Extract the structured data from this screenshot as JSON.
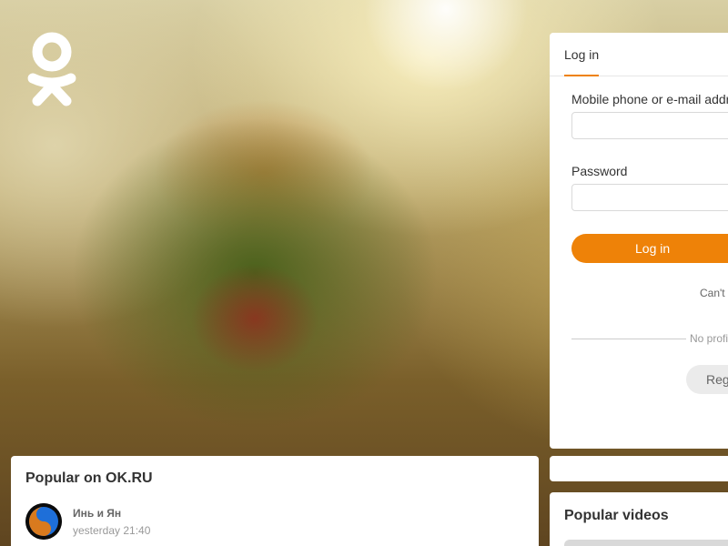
{
  "brand": {
    "logo_icon": "ok-logo-icon",
    "accent_color": "#ee8208"
  },
  "login": {
    "tab_label": "Log in",
    "phone_label": "Mobile phone or e-mail addr",
    "phone_value": "",
    "password_label": "Password",
    "password_value": "",
    "submit_label": "Log in",
    "cant_login_text": "Can't",
    "no_profile_text": "No profi",
    "register_label": "Reg"
  },
  "popular": {
    "title": "Popular on OK.RU",
    "posts": [
      {
        "author": "Инь и Ян",
        "time": "yesterday 21:40",
        "avatar_icon": "yin-yang-icon"
      }
    ]
  },
  "videos": {
    "title": "Popular videos"
  }
}
